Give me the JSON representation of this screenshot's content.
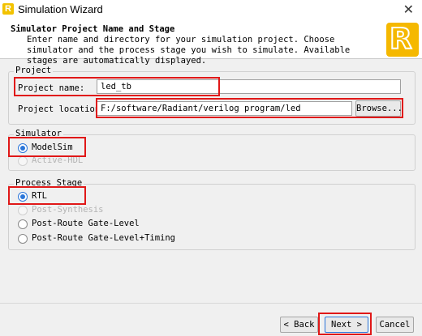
{
  "window": {
    "title": "Simulation Wizard",
    "close_glyph": "✕"
  },
  "header": {
    "heading": "Simulator Project Name and Stage",
    "description": "Enter name and directory for your simulation project. Choose simulator and the process stage you wish to simulate. Available stages are automatically displayed.",
    "logo_letter": "R"
  },
  "project": {
    "legend": "Project",
    "name_label": "Project name:",
    "name_value": "led_tb",
    "location_label": "Project location:",
    "location_value": "F:/software/Radiant/verilog program/led",
    "browse_label": "Browse..."
  },
  "simulator": {
    "legend": "Simulator",
    "options": [
      {
        "label": "ModelSim",
        "selected": true,
        "enabled": true
      },
      {
        "label": "Active-HDL",
        "selected": false,
        "enabled": false
      }
    ]
  },
  "process_stage": {
    "legend": "Process Stage",
    "options": [
      {
        "label": "RTL",
        "selected": true,
        "enabled": true
      },
      {
        "label": "Post-Synthesis",
        "selected": false,
        "enabled": false
      },
      {
        "label": "Post-Route Gate-Level",
        "selected": false,
        "enabled": true
      },
      {
        "label": "Post-Route Gate-Level+Timing",
        "selected": false,
        "enabled": true
      }
    ]
  },
  "footer": {
    "back_label": "< Back",
    "next_label": "Next >",
    "cancel_label": "Cancel"
  },
  "colors": {
    "annotation": "#e01818",
    "accent": "#2b76d9",
    "logo": "#f5b800"
  }
}
